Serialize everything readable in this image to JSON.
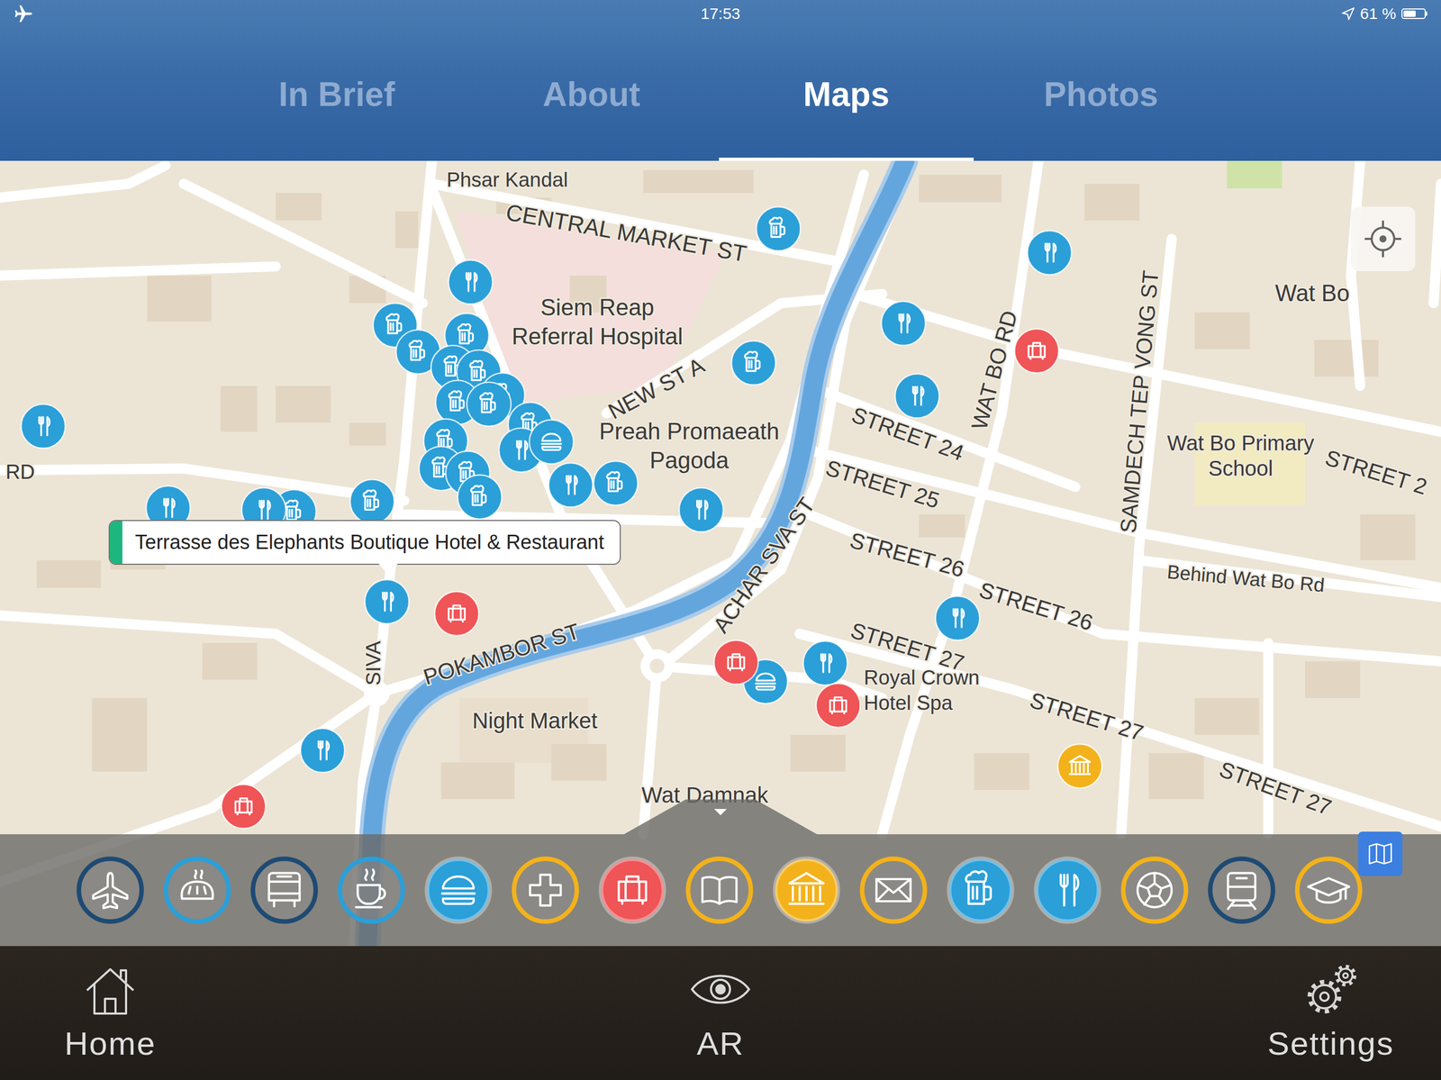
{
  "status_bar": {
    "time": "17:53",
    "battery": "61 %",
    "battery_level": 0.61,
    "airplane_mode": true,
    "location_on": true
  },
  "tabs": [
    {
      "label": "In Brief",
      "selected": false
    },
    {
      "label": "About",
      "selected": false
    },
    {
      "label": "Maps",
      "selected": true
    },
    {
      "label": "Photos",
      "selected": false
    }
  ],
  "map": {
    "labels": [
      "Phsar Kandal",
      "CENTRAL MARKET ST",
      "Siem Reap",
      "Referral Hospital",
      "NEW ST A",
      "Preah Promaeath",
      "Pagoda",
      "STREET 24",
      "STREET 25",
      "STREET 26",
      "STREET 26",
      "STREET 27",
      "STREET 27",
      "STREET 27",
      "WAT BO RD",
      "SAMDECH TEP VONG ST",
      "Wat Bo",
      "Wat Bo Primary",
      "School",
      "STREET 2",
      "Behind Wat Bo Rd",
      "ACHAR SVA ST",
      "POKAMBOR ST",
      "SIVA",
      "Night Market",
      "Wat Damnak",
      "RD",
      "Royal Crown",
      "Hotel Spa"
    ],
    "pins": [
      {
        "kind": "beer",
        "color": "#2b9fd8"
      },
      {
        "kind": "beer",
        "color": "#2b9fd8"
      },
      {
        "kind": "beer",
        "color": "#2b9fd8"
      },
      {
        "kind": "beer",
        "color": "#2b9fd8"
      },
      {
        "kind": "beer",
        "color": "#2b9fd8"
      },
      {
        "kind": "beer",
        "color": "#2b9fd8"
      },
      {
        "kind": "beer",
        "color": "#2b9fd8"
      },
      {
        "kind": "beer",
        "color": "#2b9fd8"
      },
      {
        "kind": "beer",
        "color": "#2b9fd8"
      },
      {
        "kind": "beer",
        "color": "#2b9fd8"
      },
      {
        "kind": "beer",
        "color": "#2b9fd8"
      },
      {
        "kind": "beer",
        "color": "#2b9fd8"
      },
      {
        "kind": "beer",
        "color": "#2b9fd8"
      },
      {
        "kind": "beer",
        "color": "#2b9fd8"
      },
      {
        "kind": "beer",
        "color": "#2b9fd8"
      },
      {
        "kind": "beer",
        "color": "#2b9fd8"
      },
      {
        "kind": "beer",
        "color": "#2b9fd8"
      },
      {
        "kind": "beer",
        "color": "#2b9fd8"
      },
      {
        "kind": "fork",
        "color": "#2b9fd8"
      },
      {
        "kind": "fork",
        "color": "#2b9fd8"
      },
      {
        "kind": "fork",
        "color": "#2b9fd8"
      },
      {
        "kind": "fork",
        "color": "#2b9fd8"
      },
      {
        "kind": "fork",
        "color": "#2b9fd8"
      },
      {
        "kind": "fork",
        "color": "#2b9fd8"
      },
      {
        "kind": "fork",
        "color": "#2b9fd8"
      },
      {
        "kind": "fork",
        "color": "#2b9fd8"
      },
      {
        "kind": "fork",
        "color": "#2b9fd8"
      },
      {
        "kind": "fork",
        "color": "#2b9fd8"
      },
      {
        "kind": "fork",
        "color": "#2b9fd8"
      },
      {
        "kind": "fork",
        "color": "#2b9fd8"
      },
      {
        "kind": "fork",
        "color": "#2b9fd8"
      },
      {
        "kind": "fork",
        "color": "#2b9fd8"
      },
      {
        "kind": "burger",
        "color": "#2b9fd8"
      },
      {
        "kind": "burger",
        "color": "#2b9fd8"
      },
      {
        "kind": "hotel",
        "color": "#ef5456"
      },
      {
        "kind": "hotel",
        "color": "#ef5456"
      },
      {
        "kind": "hotel",
        "color": "#ef5456"
      },
      {
        "kind": "hotel",
        "color": "#ef5456"
      },
      {
        "kind": "hotel",
        "color": "#ef5456"
      },
      {
        "kind": "museum",
        "color": "#f3b21b"
      }
    ],
    "tooltip": {
      "text": "Terrasse des Elephants Boutique Hotel & Restaurant",
      "color": "#1db67e"
    }
  },
  "categories": [
    {
      "kind": "plane",
      "color": "#1e4a73",
      "selected": false
    },
    {
      "kind": "bread",
      "color": "#2b9fd8",
      "selected": false
    },
    {
      "kind": "bus",
      "color": "#1e4a73",
      "selected": false
    },
    {
      "kind": "coffee",
      "color": "#2b9fd8",
      "selected": false
    },
    {
      "kind": "burger",
      "color": "#2b9fd8",
      "selected": true
    },
    {
      "kind": "medical",
      "color": "#f3b21b",
      "selected": false
    },
    {
      "kind": "hotel",
      "color": "#ef5456",
      "selected": true
    },
    {
      "kind": "book",
      "color": "#f3b21b",
      "selected": false
    },
    {
      "kind": "museum",
      "color": "#f3b21b",
      "selected": true
    },
    {
      "kind": "mail",
      "color": "#f3b21b",
      "selected": false
    },
    {
      "kind": "beer",
      "color": "#2b9fd8",
      "selected": true
    },
    {
      "kind": "fork",
      "color": "#2b9fd8",
      "selected": true
    },
    {
      "kind": "sports",
      "color": "#f3b21b",
      "selected": false
    },
    {
      "kind": "train",
      "color": "#1e4a73",
      "selected": false
    },
    {
      "kind": "education",
      "color": "#f3b21b",
      "selected": false
    }
  ],
  "bottom_nav": [
    {
      "label": "Home",
      "kind": "home"
    },
    {
      "label": "AR",
      "kind": "ar"
    },
    {
      "label": "Settings",
      "kind": "settings"
    }
  ]
}
